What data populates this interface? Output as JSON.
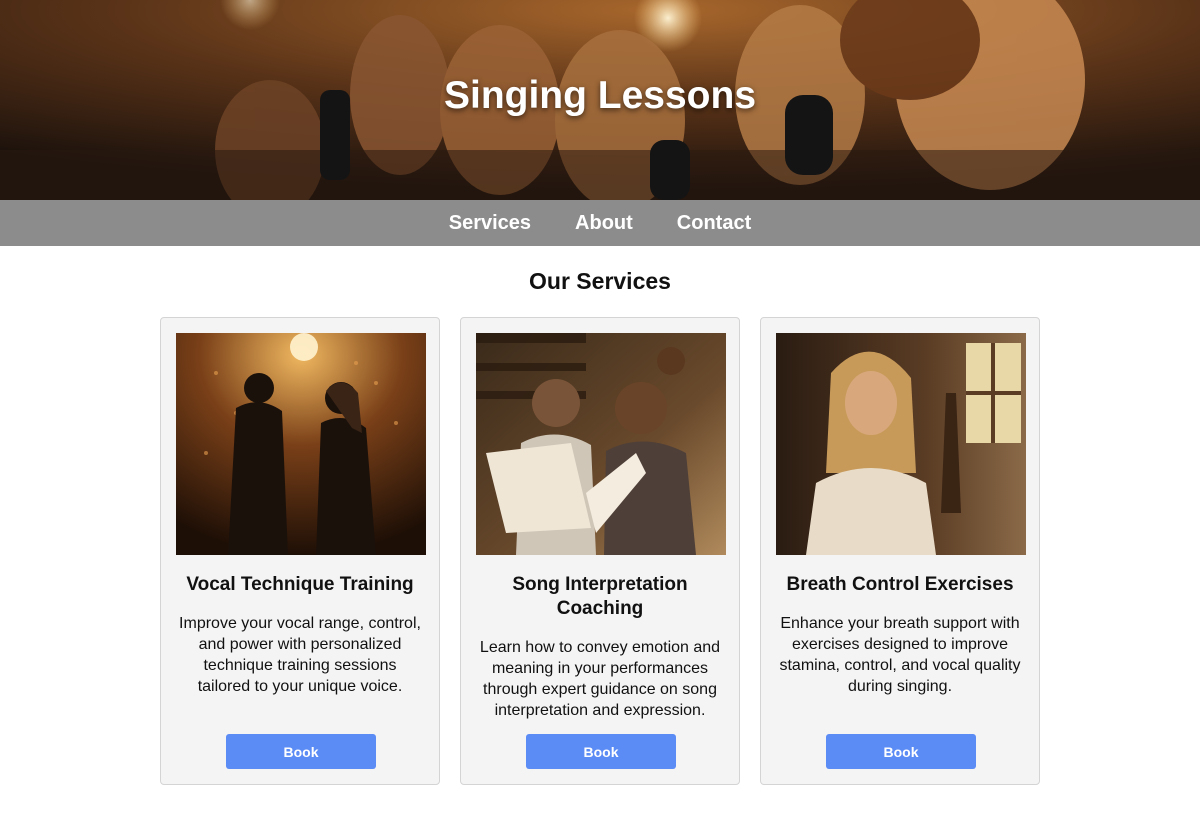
{
  "hero": {
    "title": "Singing Lessons"
  },
  "nav": {
    "items": [
      "Services",
      "About",
      "Contact"
    ]
  },
  "services": {
    "heading": "Our Services",
    "cards": [
      {
        "title": "Vocal Technique Training",
        "description": "Improve your vocal range, control, and power with personalized technique training sessions tailored to your unique voice.",
        "button": "Book"
      },
      {
        "title": "Song Interpretation Coaching",
        "description": "Learn how to convey emotion and meaning in your performances through expert guidance on song interpretation and expression.",
        "button": "Book"
      },
      {
        "title": "Breath Control Exercises",
        "description": "Enhance your breath support with exercises designed to improve stamina, control, and vocal quality during singing.",
        "button": "Book"
      }
    ]
  },
  "colors": {
    "nav_bg": "#8c8c8c",
    "button": "#5b8bf5",
    "card_bg": "#f4f4f4"
  }
}
